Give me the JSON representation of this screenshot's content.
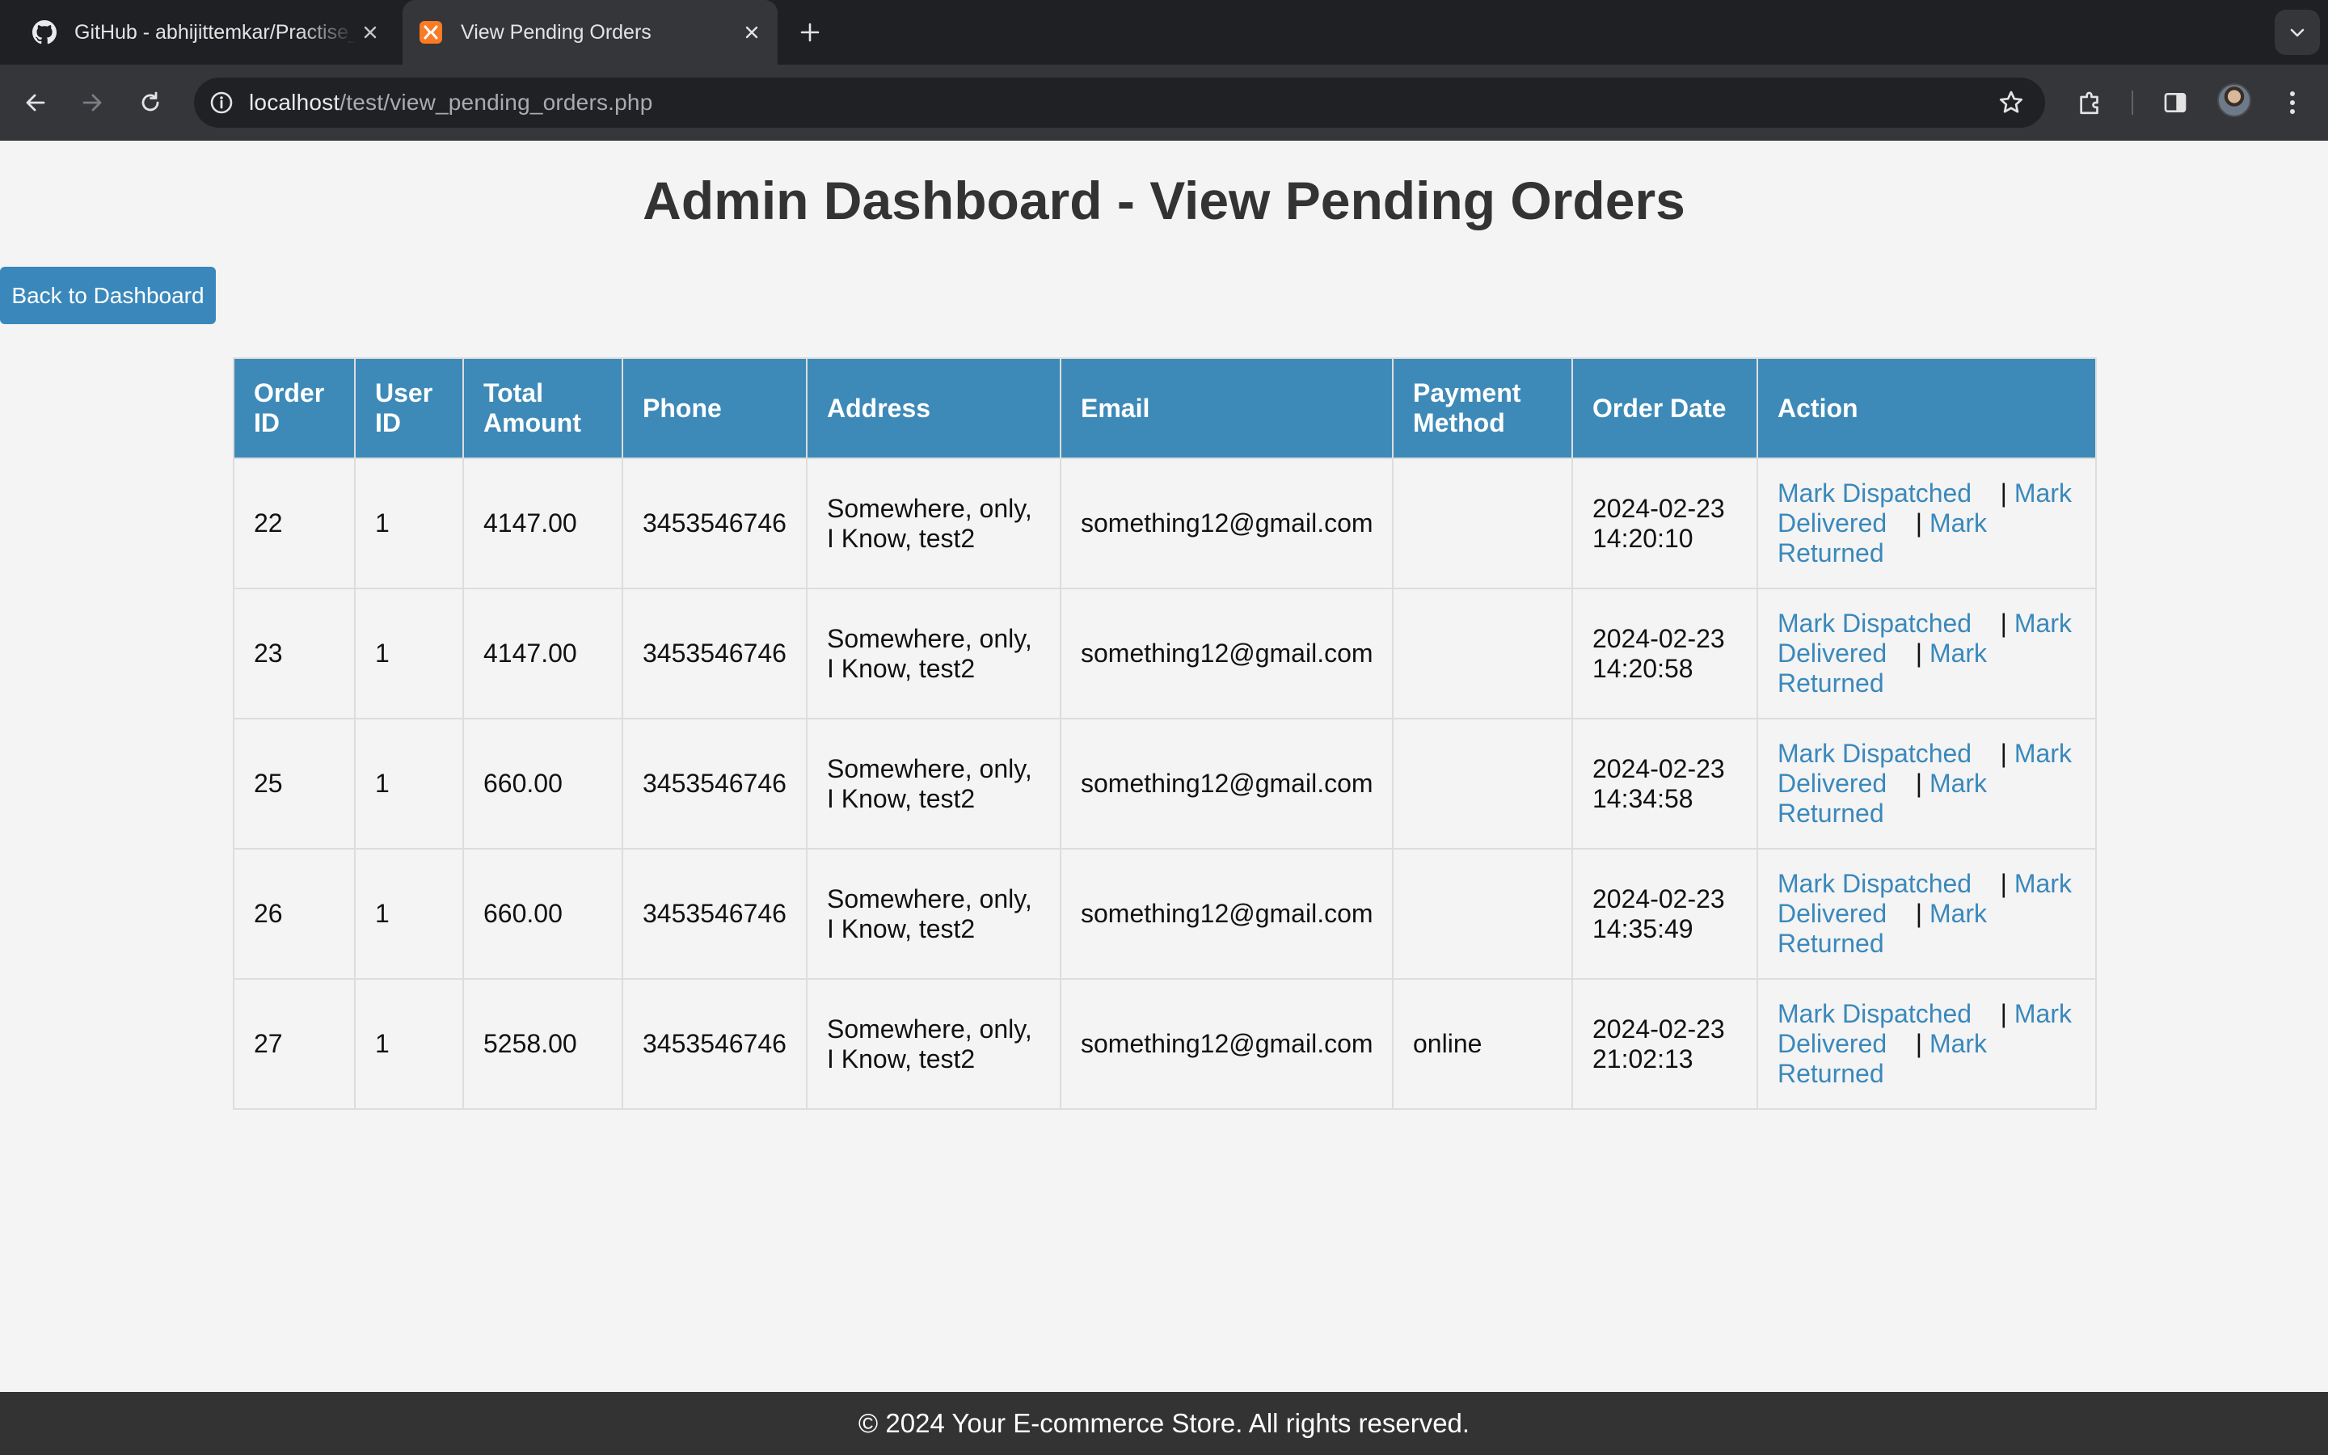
{
  "browser": {
    "tabs": [
      {
        "title": "GitHub - abhijittemkar/Practise_code",
        "favicon": "github-icon",
        "active": false
      },
      {
        "title": "View Pending Orders",
        "favicon": "xampp-icon",
        "active": true
      }
    ],
    "url_host": "localhost",
    "url_path": "/test/view_pending_orders.php"
  },
  "page": {
    "title": "Admin Dashboard - View Pending Orders",
    "back_button": "Back to Dashboard",
    "accent_color": "#3a88bb"
  },
  "table": {
    "headers": [
      "Order ID",
      "User ID",
      "Total Amount",
      "Phone",
      "Address",
      "Email",
      "Payment Method",
      "Order Date",
      "Action"
    ],
    "rows": [
      {
        "order_id": "22",
        "user_id": "1",
        "total": "4147.00",
        "phone": "3453546746",
        "address": "Somewhere, only, I Know, test2",
        "email": "something12@gmail.com",
        "payment": "",
        "date": "2024-02-23 14:20:10"
      },
      {
        "order_id": "23",
        "user_id": "1",
        "total": "4147.00",
        "phone": "3453546746",
        "address": "Somewhere, only, I Know, test2",
        "email": "something12@gmail.com",
        "payment": "",
        "date": "2024-02-23 14:20:58"
      },
      {
        "order_id": "25",
        "user_id": "1",
        "total": "660.00",
        "phone": "3453546746",
        "address": "Somewhere, only, I Know, test2",
        "email": "something12@gmail.com",
        "payment": "",
        "date": "2024-02-23 14:34:58"
      },
      {
        "order_id": "26",
        "user_id": "1",
        "total": "660.00",
        "phone": "3453546746",
        "address": "Somewhere, only, I Know, test2",
        "email": "something12@gmail.com",
        "payment": "",
        "date": "2024-02-23 14:35:49"
      },
      {
        "order_id": "27",
        "user_id": "1",
        "total": "5258.00",
        "phone": "3453546746",
        "address": "Somewhere, only, I Know, test2",
        "email": "something12@gmail.com",
        "payment": "online",
        "date": "2024-02-23 21:02:13"
      }
    ],
    "actions": {
      "dispatched": "Mark Dispatched",
      "delivered": "Mark Delivered",
      "returned": "Mark Returned",
      "separator": "|"
    }
  },
  "footer": {
    "text": "© 2024 Your E-commerce Store. All rights reserved."
  }
}
